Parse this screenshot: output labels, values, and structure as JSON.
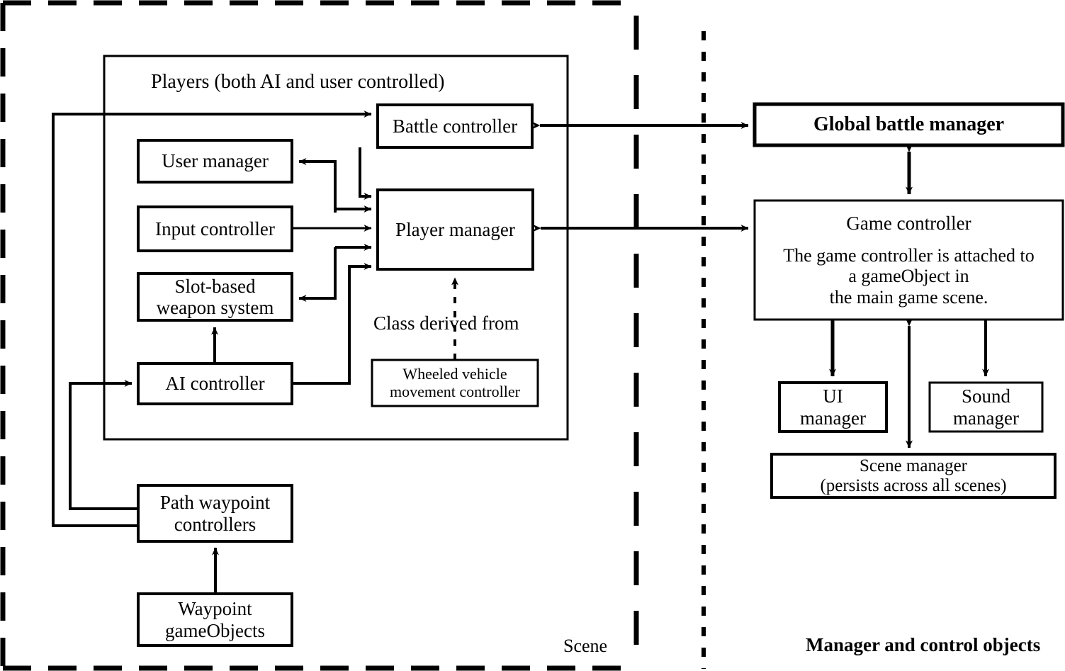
{
  "diagram": {
    "title_scene_label": "Scene",
    "title_managers_label": "Manager and control objects",
    "players_group_label": "Players (both AI and user controlled)",
    "class_derived_label": "Class derived from",
    "colors": {
      "stroke": "#000000",
      "background": "#ffffff"
    },
    "scene_nodes": [
      {
        "id": "battle-controller",
        "label": "Battle controller"
      },
      {
        "id": "user-manager",
        "label": "User manager"
      },
      {
        "id": "input-controller",
        "label": "Input controller"
      },
      {
        "id": "slot-based-weapon-system",
        "label": "Slot-based\nweapon system"
      },
      {
        "id": "ai-controller",
        "label": "AI controller"
      },
      {
        "id": "player-manager",
        "label": "Player manager"
      },
      {
        "id": "wheeled-vehicle-movement-controller",
        "label": "Wheeled vehicle\nmovement controller"
      },
      {
        "id": "path-waypoint-controllers",
        "label": "Path waypoint\ncontrollers"
      },
      {
        "id": "waypoint-gameobjects",
        "label": "Waypoint\ngameObjects"
      }
    ],
    "manager_nodes": [
      {
        "id": "global-battle-manager",
        "label": "Global battle manager"
      },
      {
        "id": "game-controller",
        "label": "Game controller"
      },
      {
        "id": "game-controller-note",
        "label": "The game controller is attached to\na gameObject in\nthe main game scene."
      },
      {
        "id": "ui-manager",
        "label": "UI\nmanager"
      },
      {
        "id": "sound-manager",
        "label": "Sound\nmanager"
      },
      {
        "id": "scene-manager",
        "label": "Scene manager\n(persists across all scenes)"
      }
    ],
    "connections": [
      {
        "from": "path-waypoint-controllers",
        "to": "battle-controller",
        "style": "solid",
        "direction": "one-way"
      },
      {
        "from": "path-waypoint-controllers",
        "to": "ai-controller",
        "style": "solid",
        "direction": "one-way"
      },
      {
        "from": "waypoint-gameobjects",
        "to": "path-waypoint-controllers",
        "style": "solid",
        "direction": "one-way"
      },
      {
        "from": "battle-controller",
        "to": "player-manager",
        "style": "solid",
        "direction": "one-way"
      },
      {
        "from": "player-manager",
        "to": "user-manager",
        "style": "solid",
        "direction": "one-way"
      },
      {
        "from": "user-manager",
        "to": "player-manager",
        "style": "solid",
        "direction": "one-way"
      },
      {
        "from": "input-controller",
        "to": "player-manager",
        "style": "solid",
        "direction": "one-way"
      },
      {
        "from": "player-manager",
        "to": "slot-based-weapon-system",
        "style": "solid",
        "direction": "one-way"
      },
      {
        "from": "ai-controller",
        "to": "player-manager",
        "style": "solid",
        "direction": "one-way"
      },
      {
        "from": "ai-controller",
        "to": "slot-based-weapon-system",
        "style": "solid",
        "direction": "one-way"
      },
      {
        "from": "wheeled-vehicle-movement-controller",
        "to": "player-manager",
        "style": "dotted",
        "direction": "one-way",
        "label": "Class derived from"
      },
      {
        "from": "battle-controller",
        "to": "global-battle-manager",
        "style": "solid",
        "direction": "two-way"
      },
      {
        "from": "player-manager",
        "to": "game-controller",
        "style": "solid",
        "direction": "two-way"
      },
      {
        "from": "global-battle-manager",
        "to": "game-controller",
        "style": "solid",
        "direction": "two-way"
      },
      {
        "from": "game-controller",
        "to": "ui-manager",
        "style": "solid",
        "direction": "one-way"
      },
      {
        "from": "game-controller",
        "to": "sound-manager",
        "style": "solid",
        "direction": "one-way"
      },
      {
        "from": "game-controller",
        "to": "scene-manager",
        "style": "solid",
        "direction": "two-way"
      }
    ],
    "dividers": [
      {
        "id": "scene-boundary",
        "style": "dashed"
      },
      {
        "id": "panel-divider",
        "style": "dotted"
      }
    ]
  }
}
